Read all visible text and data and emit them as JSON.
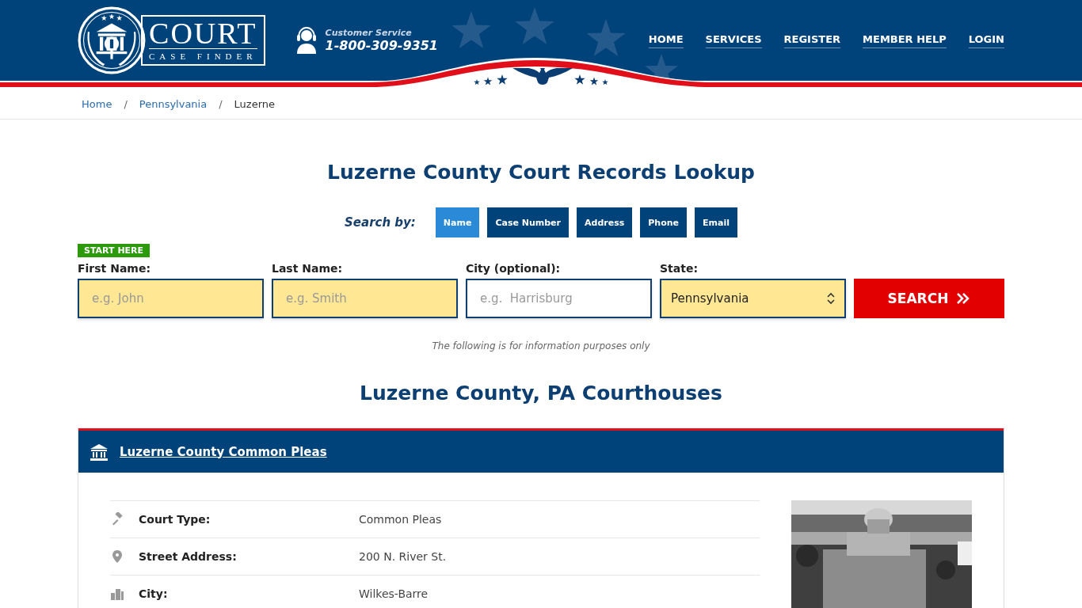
{
  "header": {
    "logo": {
      "word": "COURT",
      "tagline": "CASE FINDER"
    },
    "support": {
      "label": "Customer Service",
      "phone": "1-800-309-9351"
    },
    "nav": [
      {
        "label": "HOME"
      },
      {
        "label": "SERVICES"
      },
      {
        "label": "REGISTER"
      },
      {
        "label": "MEMBER HELP"
      },
      {
        "label": "LOGIN"
      }
    ]
  },
  "breadcrumbs": {
    "separator": "/",
    "items": [
      {
        "label": "Home",
        "link": true
      },
      {
        "label": "Pennsylvania",
        "link": true
      },
      {
        "label": "Luzerne",
        "link": false
      }
    ]
  },
  "title": "Luzerne County Court Records Lookup",
  "search": {
    "label": "Search by:",
    "tabs": [
      {
        "label": "Name",
        "selected": true
      },
      {
        "label": "Case Number",
        "selected": false
      },
      {
        "label": "Address",
        "selected": false
      },
      {
        "label": "Phone",
        "selected": false
      },
      {
        "label": "Email",
        "selected": false
      }
    ],
    "badge": "START HERE",
    "fields": [
      {
        "kind": "text",
        "label": "First Name:",
        "placeholder": "e.g. John",
        "highlighted": true
      },
      {
        "kind": "text",
        "label": "Last Name:",
        "placeholder": "e.g. Smith",
        "highlighted": true
      },
      {
        "kind": "text",
        "label": "City (optional):",
        "placeholder": "e.g.  Harrisburg",
        "highlighted": false
      },
      {
        "kind": "select",
        "label": "State:",
        "value": "Pennsylvania",
        "highlighted": true
      }
    ],
    "button": "SEARCH"
  },
  "note": "The following is for information purposes only",
  "courthouses_title": "Luzerne County, PA Courthouses",
  "courthouse": {
    "name": "Luzerne County Common Pleas",
    "details": [
      {
        "kind": "gavel",
        "label": "Court Type:",
        "value": "Common Pleas"
      },
      {
        "kind": "pin",
        "label": "Street Address:",
        "value": "200 N. River St."
      },
      {
        "kind": "city",
        "label": "City:",
        "value": "Wilkes-Barre"
      }
    ]
  }
}
